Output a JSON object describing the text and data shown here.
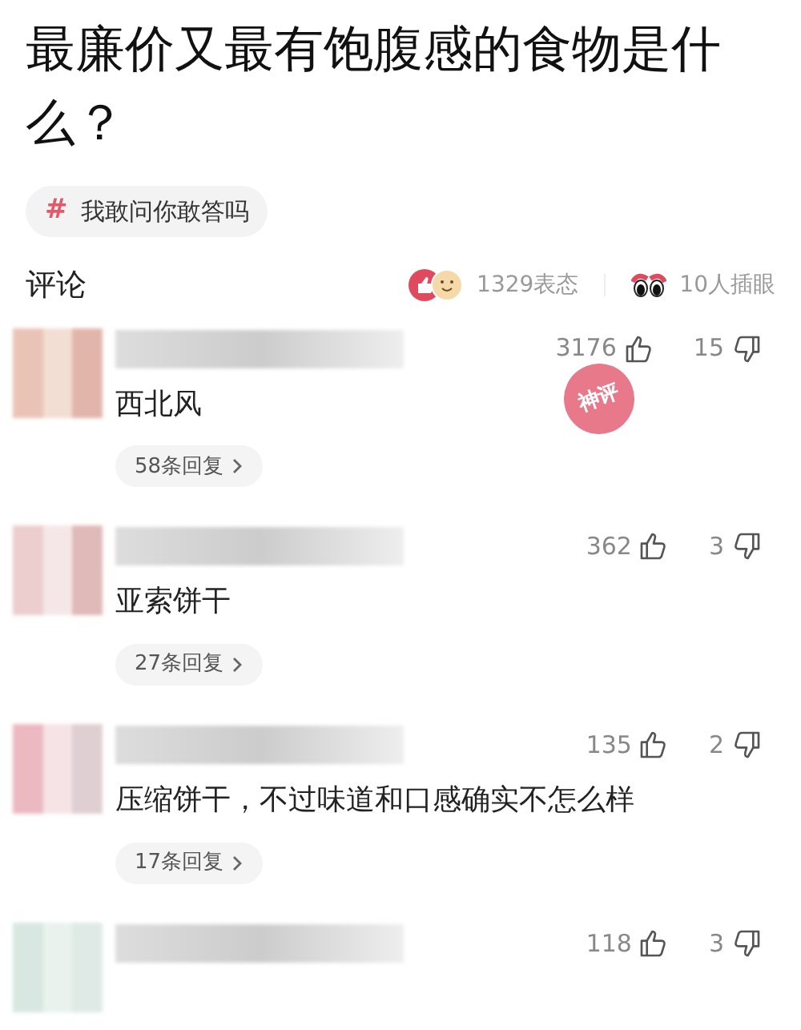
{
  "question": {
    "title": "最廉价又最有饱腹感的食物是什么？"
  },
  "topic_tag": {
    "symbol": "#",
    "label": "我敢问你敢答吗"
  },
  "comments_header": {
    "title": "评论",
    "reactions": "1329表态",
    "onlookers": "10人插眼"
  },
  "comments": [
    {
      "likes": "3176",
      "dislikes": "15",
      "text": "西北风",
      "replies": "58条回复",
      "stamp": "神评"
    },
    {
      "likes": "362",
      "dislikes": "3",
      "text": "亚索饼干",
      "replies": "27条回复"
    },
    {
      "likes": "135",
      "dislikes": "2",
      "text": "压缩饼干，不过味道和口感确实不怎么样",
      "replies": "17条回复"
    },
    {
      "likes": "118",
      "dislikes": "3"
    }
  ]
}
